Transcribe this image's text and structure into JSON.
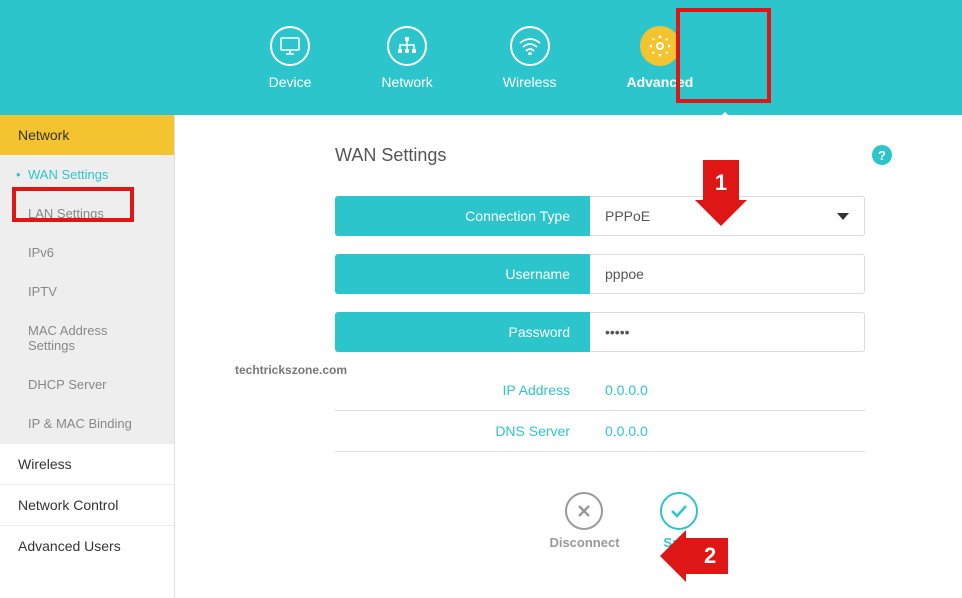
{
  "nav": {
    "device": "Device",
    "network": "Network",
    "wireless": "Wireless",
    "advanced": "Advanced"
  },
  "sidebar": {
    "header": "Network",
    "items": [
      "WAN Settings",
      "LAN Settings",
      "IPv6",
      "IPTV",
      "MAC Address Settings",
      "DHCP Server",
      "IP & MAC Binding"
    ],
    "sections": [
      "Wireless",
      "Network Control",
      "Advanced Users"
    ]
  },
  "main": {
    "title": "WAN Settings",
    "help": "?",
    "fields": {
      "connectionType": {
        "label": "Connection Type",
        "value": "PPPoE"
      },
      "username": {
        "label": "Username",
        "value": "pppoe"
      },
      "password": {
        "label": "Password",
        "value": "•••••"
      }
    },
    "info": {
      "ipAddress": {
        "label": "IP Address",
        "value": "0.0.0.0"
      },
      "dnsServer": {
        "label": "DNS Server",
        "value": "0.0.0.0"
      }
    },
    "actions": {
      "disconnect": "Disconnect",
      "save": "Save"
    }
  },
  "annotations": {
    "arrow1": "1",
    "arrow2": "2"
  },
  "watermark": "techtrickszone.com"
}
